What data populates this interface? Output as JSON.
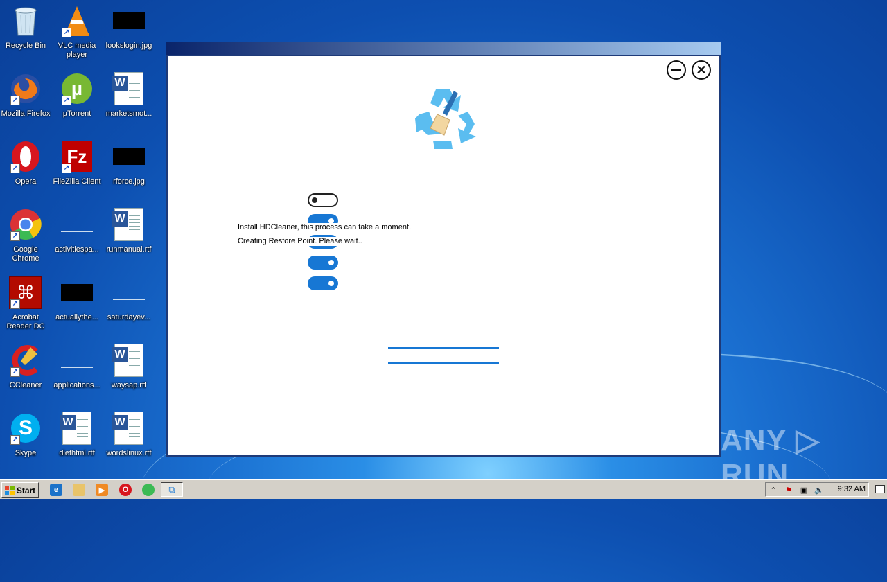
{
  "desktop": {
    "icons": [
      {
        "label": "Recycle Bin",
        "icon": "recycle-bin-icon"
      },
      {
        "label": "VLC media player",
        "icon": "vlc-icon"
      },
      {
        "label": "lookslogin.jpg",
        "icon": "image-file-icon"
      },
      {
        "label": "Mozilla Firefox",
        "icon": "firefox-icon"
      },
      {
        "label": "µTorrent",
        "icon": "utorrent-icon"
      },
      {
        "label": "marketsmot...",
        "icon": "word-document-icon"
      },
      {
        "label": "Opera",
        "icon": "opera-icon"
      },
      {
        "label": "FileZilla Client",
        "icon": "filezilla-icon"
      },
      {
        "label": "rforce.jpg",
        "icon": "image-file-icon"
      },
      {
        "label": "Google Chrome",
        "icon": "chrome-icon"
      },
      {
        "label": "activitiespa...",
        "icon": "file-icon"
      },
      {
        "label": "runmanual.rtf",
        "icon": "word-document-icon"
      },
      {
        "label": "Acrobat Reader DC",
        "icon": "acrobat-icon"
      },
      {
        "label": "actuallythe...",
        "icon": "image-file-icon"
      },
      {
        "label": "saturdayev...",
        "icon": "file-icon"
      },
      {
        "label": "CCleaner",
        "icon": "ccleaner-icon"
      },
      {
        "label": "applications...",
        "icon": "file-icon"
      },
      {
        "label": "waysap.rtf",
        "icon": "word-document-icon"
      },
      {
        "label": "Skype",
        "icon": "skype-icon"
      },
      {
        "label": "diethtml.rtf",
        "icon": "word-document-icon"
      },
      {
        "label": "wordslinux.rtf",
        "icon": "word-document-icon"
      }
    ]
  },
  "installer": {
    "status_line_1": "Install HDCleaner, this process can take a moment.",
    "status_line_2": "Creating Restore Point. Please wait..",
    "toggles": [
      false,
      true,
      true,
      true,
      true
    ],
    "accent_color": "#1777d4"
  },
  "watermark": {
    "text": "ANY ▷ RUN"
  },
  "taskbar": {
    "start_label": "Start",
    "clock": "9:32 AM",
    "tray_expand": "⌃"
  }
}
